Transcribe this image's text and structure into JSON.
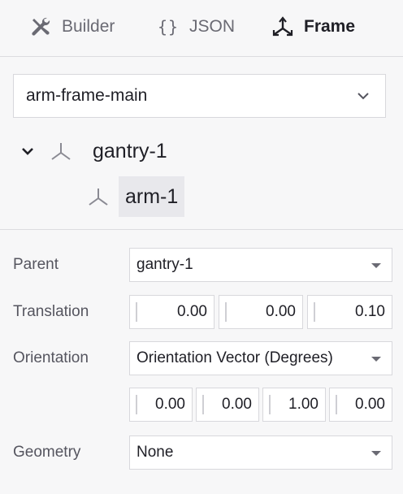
{
  "tabs": [
    {
      "label": "Builder",
      "icon": "tools-icon"
    },
    {
      "label": "JSON",
      "icon": "braces-icon",
      "glyph": "{}"
    },
    {
      "label": "Frame",
      "icon": "frame-axes-icon",
      "active": true
    }
  ],
  "frame_selector": {
    "value": "arm-frame-main",
    "icon": "chevron-down-icon"
  },
  "tree": {
    "parent": {
      "label": "gantry-1",
      "expanded": true
    },
    "child": {
      "label": "arm-1",
      "selected": true
    }
  },
  "form": {
    "parent": {
      "label": "Parent",
      "value": "gantry-1"
    },
    "translation": {
      "label": "Translation",
      "x": "0.00",
      "y": "0.00",
      "z": "0.10"
    },
    "orientation": {
      "label": "Orientation",
      "type": "Orientation Vector (Degrees)",
      "x": "0.00",
      "y": "0.00",
      "z": "1.00",
      "theta": "0.00"
    },
    "geometry": {
      "label": "Geometry",
      "value": "None"
    }
  },
  "colors": {
    "background": "#f7f7f8",
    "selected_row": "#e8e8ec",
    "border": "#d8d8dc"
  }
}
